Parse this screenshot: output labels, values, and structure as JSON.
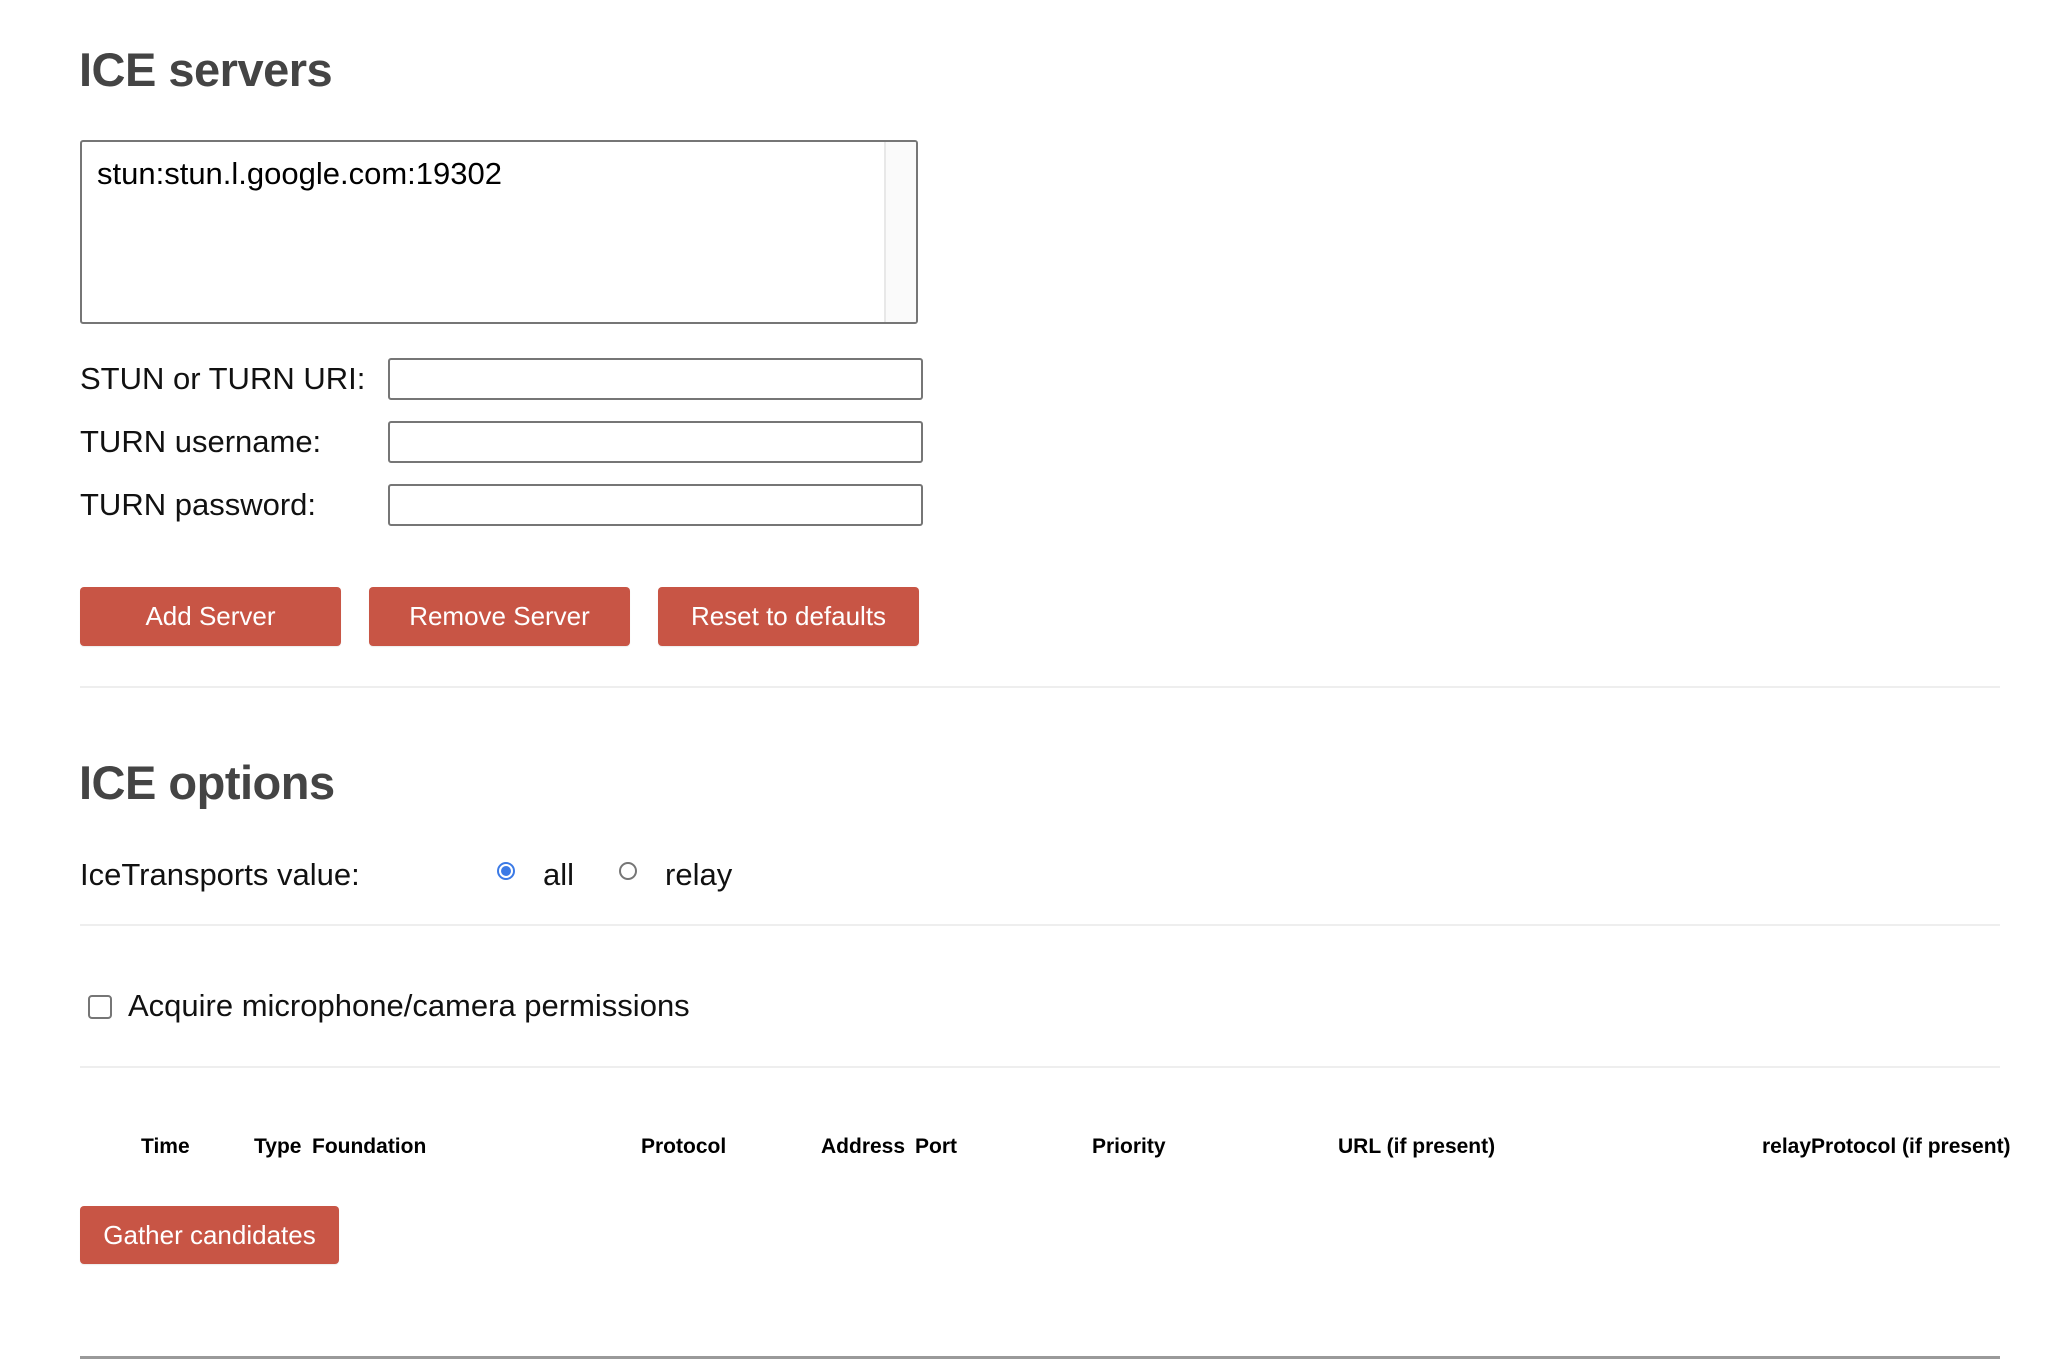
{
  "ice_servers": {
    "heading": "ICE servers",
    "servers_list": [
      "stun:stun.l.google.com:19302"
    ],
    "fields": [
      {
        "label": "STUN or TURN URI:",
        "value": "",
        "placeholder": ""
      },
      {
        "label": "TURN username:",
        "value": "",
        "placeholder": ""
      },
      {
        "label": "TURN password:",
        "value": "",
        "placeholder": ""
      }
    ],
    "buttons": {
      "add": "Add Server",
      "remove": "Remove Server",
      "reset": "Reset to defaults"
    }
  },
  "ice_options": {
    "heading": "ICE options",
    "transports_label": "IceTransports value:",
    "transport_options": [
      {
        "label": "all",
        "checked": true
      },
      {
        "label": "relay",
        "checked": false
      }
    ],
    "permissions_checkbox": {
      "label": "Acquire microphone/camera permissions",
      "checked": false
    }
  },
  "candidates_table": {
    "columns": [
      "Time",
      "Type",
      "Foundation",
      "Protocol",
      "Address",
      "Port",
      "Priority",
      "URL (if present)",
      "relayProtocol (if present)"
    ],
    "rows": []
  },
  "gather_button": "Gather candidates",
  "colors": {
    "button": "#c85545",
    "heading": "#444444",
    "radio_accent": "#3b7ae6"
  }
}
